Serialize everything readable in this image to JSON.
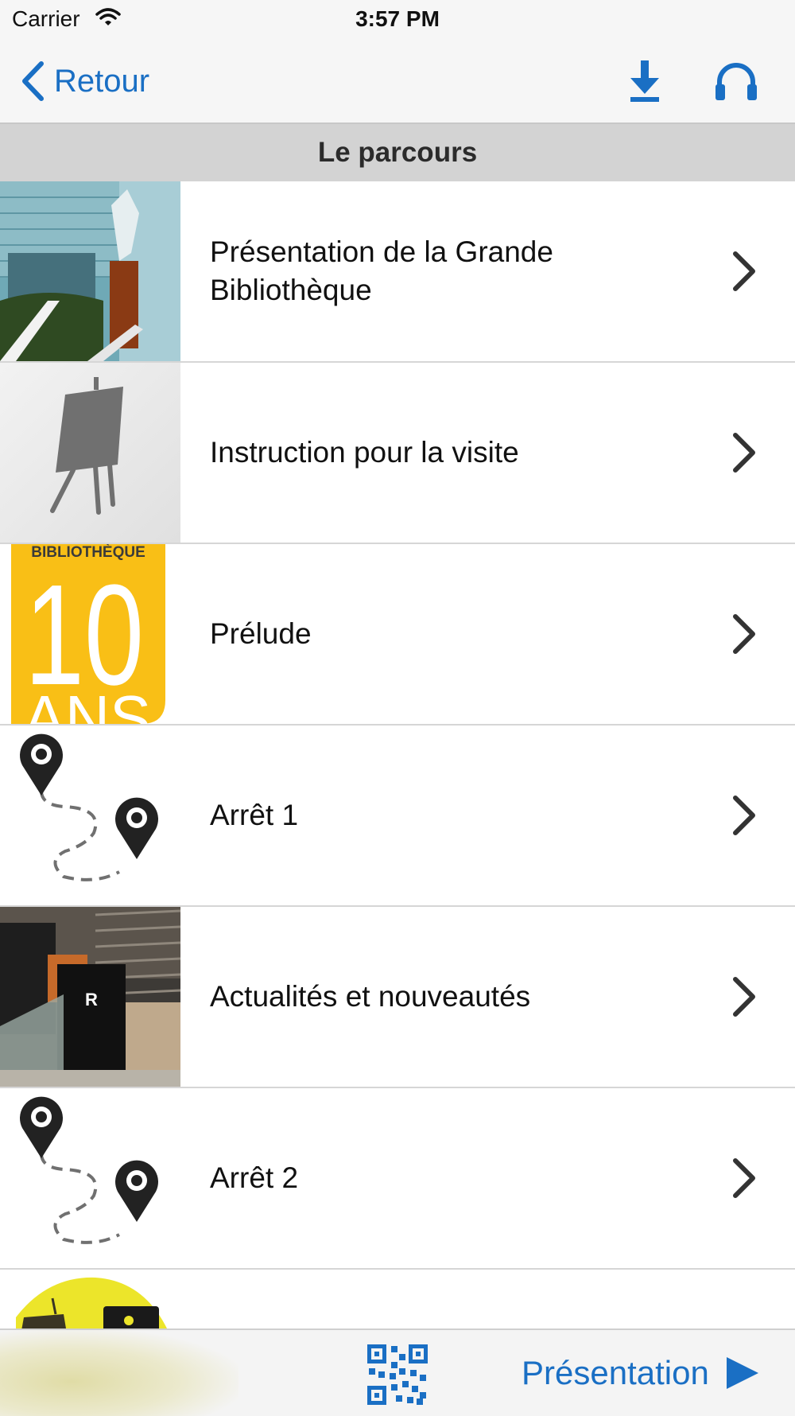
{
  "status_bar": {
    "carrier": "Carrier",
    "time": "3:57 PM"
  },
  "nav": {
    "back_label": "Retour",
    "icons": [
      "download-icon",
      "headphones-icon"
    ],
    "accent": "#1a6fc4"
  },
  "section": {
    "title": "Le parcours"
  },
  "list": {
    "items": [
      {
        "title": "Présentation de la Grande Bibliothèque",
        "thumbnail": "building-photo"
      },
      {
        "title": "Instruction pour la visite",
        "thumbnail": "easel-icon"
      },
      {
        "title": "Prélude",
        "thumbnail": "10-ans-logo"
      },
      {
        "title": "Arrêt 1",
        "thumbnail": "route-pins-icon"
      },
      {
        "title": "Actualités et nouveautés",
        "thumbnail": "interior-photo"
      },
      {
        "title": "Arrêt 2",
        "thumbnail": "route-pins-icon"
      },
      {
        "title": "",
        "thumbnail": "yellow-illustration"
      }
    ],
    "logo_text": {
      "top": "BIBLIOTHÈQUE",
      "number": "10",
      "bottom": "ANS"
    },
    "sign_letter": "R"
  },
  "toolbar": {
    "next_label": "Présentation",
    "icons": [
      "qr-code-icon",
      "play-arrow-icon"
    ]
  }
}
